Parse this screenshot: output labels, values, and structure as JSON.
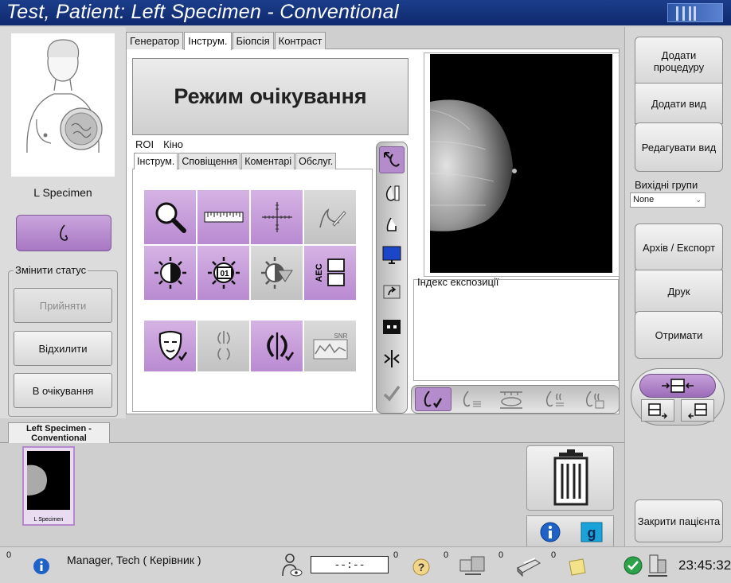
{
  "window": {
    "title": "Test, Patient:  Left Specimen - Conventional"
  },
  "left": {
    "specimen_label": "L Specimen",
    "change_status_legend": "Змінити статус",
    "accept": "Прийняти",
    "reject": "Відхилити",
    "pending": "В очікування"
  },
  "center": {
    "tabs": [
      "Генератор",
      "Інструм.",
      "Біопсія",
      "Контраст"
    ],
    "standby": "Режим очікування",
    "subtabs_top": [
      "ROI",
      "Кіно"
    ],
    "subtabs": [
      "Інструм.",
      "Сповіщення",
      "Коментарі",
      "Обслуг."
    ],
    "exposure_index": "Індекс експозиції",
    "tool_text_01": "01",
    "tool_text_aec": "AEC",
    "tool_text_snr": "SNR"
  },
  "right": {
    "add_procedure": "Додати процедуру",
    "add_view": "Додати вид",
    "edit_view": "Редагувати вид",
    "output_groups": "Вихідні групи",
    "output_value": "None",
    "archive_export": "Архів / Експорт",
    "print": "Друк",
    "retrieve": "Отримати",
    "close_patient": "Закрити пацієнта"
  },
  "thumbnails": {
    "tab_label": "Left Specimen - Conventional",
    "thumb_label": "L Specimen"
  },
  "statusbar": {
    "user": "Manager, Tech ( Керівник )",
    "timer": "--:--",
    "count_info": "0",
    "count_timer": "0",
    "count_help": "0",
    "count_transfer": "0",
    "count_print": "0",
    "count_notes": "0",
    "time": "23:45:32"
  },
  "colors": {
    "accent_purple": "#b98ad1",
    "title_blue": "#1b3d8a"
  },
  "icons": [
    "magnifier-icon",
    "ruler-icon",
    "crosshair-icon",
    "freehand-icon",
    "contrast-icon",
    "window-level-icon",
    "gray-invert-icon",
    "aec-icon"
  ]
}
